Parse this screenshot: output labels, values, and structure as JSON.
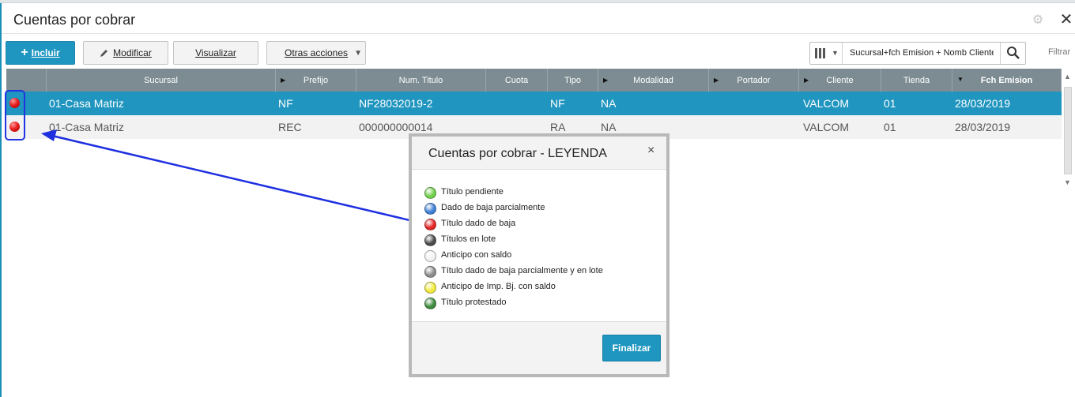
{
  "header": {
    "title": "Cuentas por cobrar",
    "settings_icon": "gear-icon",
    "close_icon": "close-icon"
  },
  "toolbar": {
    "incluir_plus": "+",
    "incluir": "Incluir",
    "modificar": "Modificar",
    "visualizar": "Visualizar",
    "otras_acciones": "Otras acciones",
    "search_value": "Sucursal+fch Emision + Nomb Cliente + I",
    "filtrar": "Filtrar"
  },
  "grid": {
    "columns": [
      "",
      "Sucursal",
      "Prefijo",
      "Num. Titulo",
      "Cuota",
      "Tipo",
      "Modalidad",
      "Portador",
      "Cliente",
      "Tienda",
      "Fch Emision"
    ],
    "rows": [
      {
        "status": "red",
        "sucursal": "01-Casa Matriz",
        "prefijo": "NF",
        "num_titulo": "NF28032019-2",
        "cuota": "",
        "tipo": "NF",
        "modalidad": "NA",
        "portador": "",
        "cliente": "VALCOM",
        "tienda": "01",
        "fch_emision": "28/03/2019"
      },
      {
        "status": "red",
        "sucursal": "01-Casa Matriz",
        "prefijo": "REC",
        "num_titulo": "000000000014",
        "cuota": "",
        "tipo": "RA",
        "modalidad": "NA",
        "portador": "",
        "cliente": "VALCOM",
        "tienda": "01",
        "fch_emision": "28/03/2019"
      }
    ]
  },
  "modal": {
    "title": "Cuentas por cobrar - LEYENDA",
    "close": "×",
    "items": [
      {
        "label": "Título pendiente",
        "color": "#6fd04a"
      },
      {
        "label": "Dado de baja parcialmente",
        "color": "#3f7fd6"
      },
      {
        "label": "Título dado de baja",
        "color": "#e32424"
      },
      {
        "label": "Títulos en lote",
        "color": "#4a4a4a"
      },
      {
        "label": "Anticipo con saldo",
        "color": "#f2f2f2"
      },
      {
        "label": "Título dado de baja parcialmente y en lote",
        "color": "#8c8c8c"
      },
      {
        "label": "Anticipo de Imp. Bj. con saldo",
        "color": "#f1ea3c"
      },
      {
        "label": "Título protestado",
        "color": "#3c8a3c"
      }
    ],
    "finalizar": "Finalizar"
  },
  "annotation": {
    "highlight_color": "#2234e0"
  }
}
